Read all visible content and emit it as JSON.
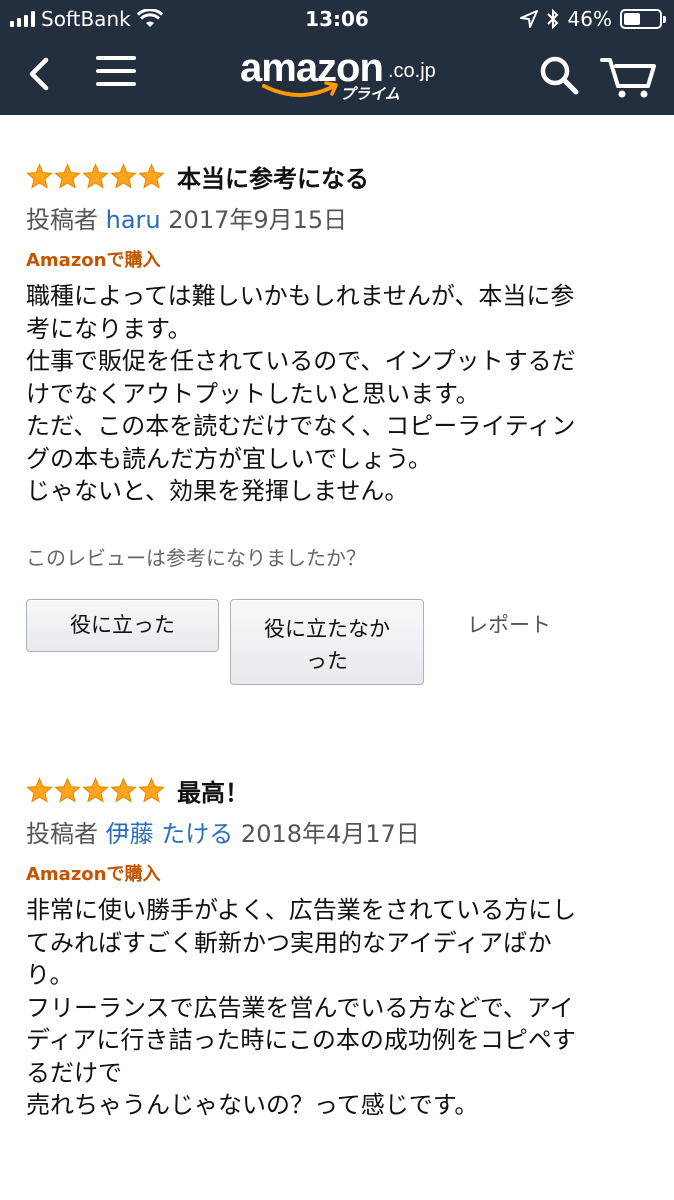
{
  "status_bar": {
    "carrier": "SoftBank",
    "time": "13:06",
    "battery": "46%",
    "battery_level": 0.46
  },
  "header": {
    "logo_word": "amazon",
    "logo_tld": ".co.jp",
    "logo_prime": "プライム",
    "icons": [
      "back-icon",
      "menu-icon",
      "search-icon",
      "cart-icon"
    ],
    "accent_color": "#ff9900",
    "background_color": "#232f3e"
  },
  "reviews": [
    {
      "stars": 5,
      "title": "本当に参考になる",
      "by_label": "投稿者",
      "author": "haru",
      "date": "2017年9月15日",
      "verified": "Amazonで購入",
      "body": [
        "職種によっては難しいかもしれませんが、本当に参",
        "考になります。",
        "仕事で販促を任されているので、インプットするだ",
        "けでなくアウトプットしたいと思います。",
        "ただ、この本を読むだけでなく、コピーライティン",
        "グの本も読んだ方が宜しいでしょう。",
        "じゃないと、効果を発揮しません。"
      ],
      "helpful_question": "このレビューは参考になりましたか？",
      "helpful_button": "役に立った",
      "not_helpful_line1": "役に立たなか",
      "not_helpful_line2": "った",
      "report": "レポート"
    },
    {
      "stars": 5,
      "title": "最高！",
      "by_label": "投稿者",
      "author": "伊藤 たける",
      "date": "2018年4月17日",
      "verified": "Amazonで購入",
      "body": [
        "非常に使い勝手がよく、広告業をされている方にし",
        "てみればすごく斬新かつ実用的なアイディアばか",
        "り。",
        "フリーランスで広告業を営んでいる方などで、アイ",
        "ディアに行き詰った時にこの本の成功例をコピペす",
        "るだけで",
        "売れちゃうんじゃないの？って感じです。"
      ]
    }
  ]
}
